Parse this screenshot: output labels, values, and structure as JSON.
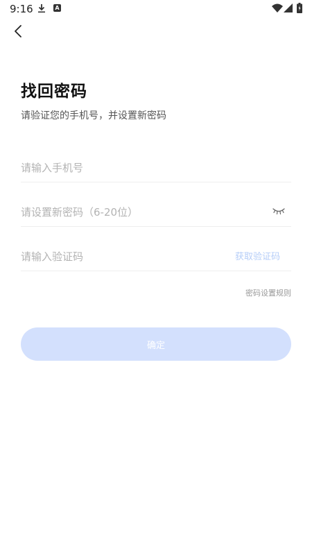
{
  "status_bar": {
    "time": "9:16",
    "icons": [
      "download-icon",
      "a-notification-icon",
      "wifi-icon",
      "signal-icon",
      "battery-icon"
    ],
    "a_icon_letter": "A"
  },
  "nav": {
    "back_icon": "chevron-left-icon"
  },
  "header": {
    "title": "找回密码",
    "subtitle": "请验证您的手机号，并设置新密码"
  },
  "form": {
    "phone_placeholder": "请输入手机号",
    "password_placeholder": "请设置新密码（6-20位）",
    "password_toggle_icon": "eye-closed-icon",
    "code_placeholder": "请输入验证码",
    "get_code_label": "获取验证码"
  },
  "rules_label": "密码设置规则",
  "confirm_label": "确定",
  "colors": {
    "primary_disabled": "#d3e0fd",
    "link_disabled": "#b5cdf8",
    "placeholder": "#b3b3b3",
    "divider": "#eeeeee"
  }
}
